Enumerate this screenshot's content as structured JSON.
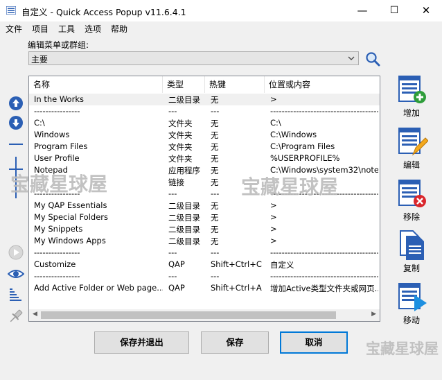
{
  "window": {
    "title": "自定义 - Quick Access Popup v11.6.4.1",
    "minimize": "—",
    "maximize": "☐",
    "close": "✕"
  },
  "menu": [
    "文件",
    "项目",
    "工具",
    "选项",
    "帮助"
  ],
  "group": {
    "label": "编辑菜单或群组:",
    "selected": "主要"
  },
  "list": {
    "columns": [
      "名称",
      "类型",
      "热键",
      "位置或内容"
    ],
    "rows": [
      {
        "name": "In the Works",
        "type": "二级目录",
        "hotkey": "无",
        "location": ">"
      },
      {
        "name": "----------------",
        "type": "---",
        "hotkey": "---",
        "location": "------------------------------------------"
      },
      {
        "name": "C:\\",
        "type": "文件夹",
        "hotkey": "无",
        "location": "C:\\"
      },
      {
        "name": "Windows",
        "type": "文件夹",
        "hotkey": "无",
        "location": "C:\\Windows"
      },
      {
        "name": "Program Files",
        "type": "文件夹",
        "hotkey": "无",
        "location": "C:\\Program Files"
      },
      {
        "name": "User Profile",
        "type": "文件夹",
        "hotkey": "无",
        "location": "%USERPROFILE%"
      },
      {
        "name": "Notepad",
        "type": "应用程序",
        "hotkey": "无",
        "location": "C:\\Windows\\system32\\note"
      },
      {
        "name": "",
        "type": "链接",
        "hotkey": "无",
        "location": ""
      },
      {
        "name": "----------------",
        "type": "---",
        "hotkey": "---",
        "location": "------------------------------------------"
      },
      {
        "name": "My QAP Essentials",
        "type": "二级目录",
        "hotkey": "无",
        "location": ">"
      },
      {
        "name": "My Special Folders",
        "type": "二级目录",
        "hotkey": "无",
        "location": ">"
      },
      {
        "name": "My Snippets",
        "type": "二级目录",
        "hotkey": "无",
        "location": ">"
      },
      {
        "name": "My Windows Apps",
        "type": "二级目录",
        "hotkey": "无",
        "location": ">"
      },
      {
        "name": "----------------",
        "type": "---",
        "hotkey": "---",
        "location": "------------------------------------------"
      },
      {
        "name": "Customize",
        "type": "QAP",
        "hotkey": "Shift+Ctrl+C",
        "location": "自定义"
      },
      {
        "name": "----------------",
        "type": "---",
        "hotkey": "---",
        "location": "------------------------------------------"
      },
      {
        "name": "Add Active Folder or Web page...",
        "type": "QAP",
        "hotkey": "Shift+Ctrl+A",
        "location": "增加Active类型文件夹或网页..."
      }
    ]
  },
  "side_icons": [
    "arrow-up-icon",
    "arrow-down-icon",
    "separator-icon",
    "column-break-icon",
    "play-icon",
    "eye-icon",
    "sort-icon",
    "pin-icon"
  ],
  "right_buttons": {
    "add": "增加",
    "edit": "编辑",
    "remove": "移除",
    "copy": "复制",
    "move": "移动"
  },
  "bottom_buttons": {
    "save_exit": "保存并退出",
    "save": "保存",
    "cancel": "取消"
  },
  "watermark": "宝藏星球屋",
  "colors": {
    "accent": "#0078d7",
    "icon_blue": "#2b5fb4",
    "add_green": "#2e9d3a",
    "remove_red": "#d9262c"
  }
}
